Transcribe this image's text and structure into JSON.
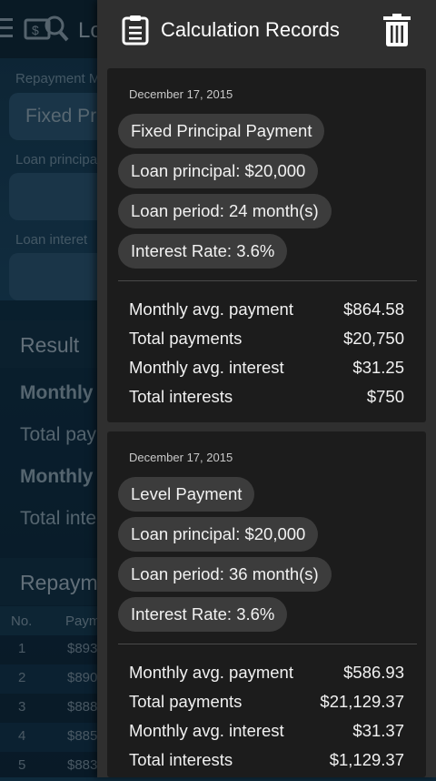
{
  "background": {
    "app_title": "Lo",
    "repayment_label": "Repayment M",
    "repayment_value": "Fixed Pri",
    "principal_label": "Loan principa",
    "interest_label": "Loan interet",
    "result_heading": "Result",
    "result_rows": [
      "Monthly a",
      "Total pay",
      "Monthly a",
      "Total inte"
    ],
    "repayment_heading": "Repaym",
    "table_headers": [
      "No.",
      "Paym"
    ],
    "table_rows": [
      {
        "no": "1",
        "pay": "$893"
      },
      {
        "no": "2",
        "pay": "$890"
      },
      {
        "no": "3",
        "pay": "$888"
      },
      {
        "no": "4",
        "pay": "$885"
      },
      {
        "no": "5",
        "pay": "$883"
      }
    ]
  },
  "drawer": {
    "title": "Calculation Records",
    "records": [
      {
        "date": "December 17, 2015",
        "method": "Fixed Principal Payment",
        "principal": "Loan principal: $20,000",
        "period": "Loan period: 24 month(s)",
        "rate": "Interest Rate: 3.6%",
        "stats": [
          {
            "label": "Monthly avg. payment",
            "value": "$864.58"
          },
          {
            "label": "Total payments",
            "value": "$20,750"
          },
          {
            "label": "Monthly avg. interest",
            "value": "$31.25"
          },
          {
            "label": "Total interests",
            "value": "$750"
          }
        ]
      },
      {
        "date": "December 17, 2015",
        "method": "Level Payment",
        "principal": "Loan principal: $20,000",
        "period": "Loan period: 36 month(s)",
        "rate": "Interest Rate: 3.6%",
        "stats": [
          {
            "label": "Monthly avg. payment",
            "value": "$586.93"
          },
          {
            "label": "Total payments",
            "value": "$21,129.37"
          },
          {
            "label": "Monthly avg. interest",
            "value": "$31.37"
          },
          {
            "label": "Total interests",
            "value": "$1,129.37"
          }
        ]
      }
    ]
  },
  "colors": {
    "drawer_bg": "#2f2f2f",
    "card_bg": "#1c1c1c",
    "chip_bg": "#3c3c3c",
    "app_bg": "#153a52"
  },
  "icons": [
    "menu-icon",
    "loan-calculator-logo-icon",
    "clipboard-icon",
    "trash-icon"
  ]
}
